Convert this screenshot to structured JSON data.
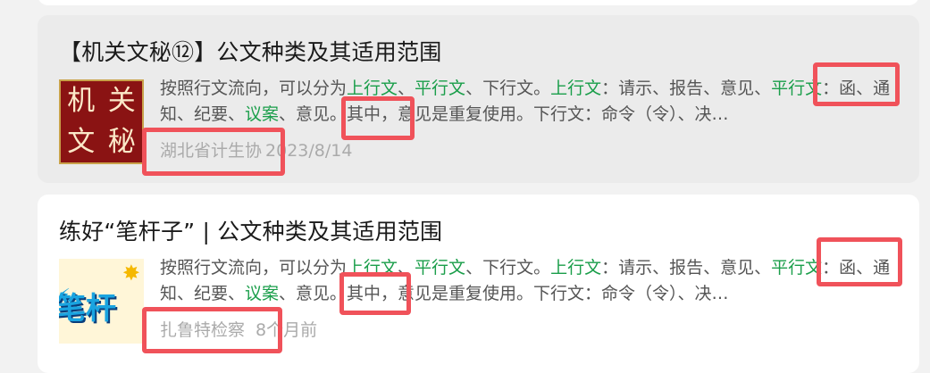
{
  "results": [
    {
      "title": "【机关文秘⑫】公文种类及其适用范围",
      "thumb_text": [
        "机",
        "关",
        "文",
        "秘"
      ],
      "snippet": [
        {
          "t": "按照行文流向，可以分为",
          "hl": false
        },
        {
          "t": "上行文",
          "hl": true
        },
        {
          "t": "、",
          "hl": false
        },
        {
          "t": "平行文",
          "hl": true
        },
        {
          "t": "、下行文。",
          "hl": false
        },
        {
          "t": "上行文",
          "hl": true
        },
        {
          "t": "：请示、报告、意见、",
          "hl": false
        },
        {
          "t": "平行文",
          "hl": true
        },
        {
          "t": "：函、通知、纪要、",
          "hl": false
        },
        {
          "t": "议案",
          "hl": true
        },
        {
          "t": "、意见。其中，意见是重复使用。下行文：命令（令）、决…",
          "hl": false
        }
      ],
      "source": "湖北省计生协",
      "date": "2023/8/14"
    },
    {
      "title": "练好“笔杆子” | 公文种类及其适用范围",
      "thumb_text": [
        "笔杆"
      ],
      "snippet": [
        {
          "t": "按照行文流向，可以分为",
          "hl": false
        },
        {
          "t": "上行文",
          "hl": true
        },
        {
          "t": "、",
          "hl": false
        },
        {
          "t": "平行文",
          "hl": true
        },
        {
          "t": "、下行文。",
          "hl": false
        },
        {
          "t": "上行文",
          "hl": true
        },
        {
          "t": "：请示、报告、意见、",
          "hl": false
        },
        {
          "t": "平行文",
          "hl": true
        },
        {
          "t": "：函、通知、纪要、",
          "hl": false
        },
        {
          "t": "议案",
          "hl": true
        },
        {
          "t": "、意见。其中，意见是重复使用。下行文：命令（令）、决…",
          "hl": false
        }
      ],
      "source": "扎鲁特检察",
      "date": "8个月前"
    }
  ],
  "colors": {
    "highlight": "#1a9e4a",
    "annotation_box": "#f0525a",
    "meta_text": "#aaaaaa"
  }
}
